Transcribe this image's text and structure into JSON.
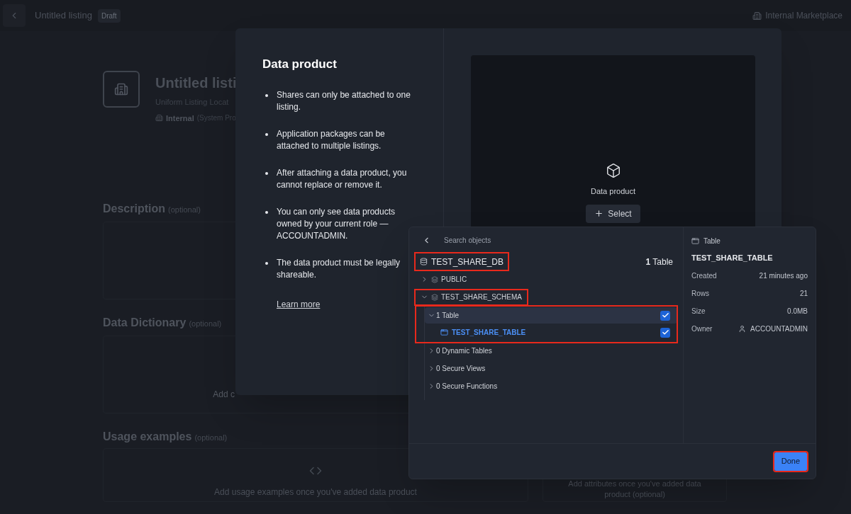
{
  "top_bar": {
    "title": "Untitled listing",
    "badge": "Draft",
    "workspace": "Internal Marketplace"
  },
  "listing": {
    "title": "Untitled listi",
    "locator": "Uniform Listing Locat",
    "visibility": "Internal",
    "visibility_note": "(System Pro"
  },
  "sections": [
    {
      "title": "Description",
      "note": "(optional)"
    },
    {
      "title": "Data Dictionary",
      "note": "(optional)",
      "hint": "Add c"
    }
  ],
  "usage": {
    "title": "Usage examples",
    "note": "(optional)",
    "hint": "Add usage examples once you've added data product",
    "side_hint": "Add attributes once you've added data product (optional)"
  },
  "modal": {
    "title": "Data product",
    "bullets": [
      "Shares can only be attached to one listing.",
      "Application packages can be attached to multiple listings.",
      "After attaching a data product, you cannot replace or remove it.",
      "You can only see data products owned by your current role — ACCOUNTADMIN.",
      "The data product must be legally shareable."
    ],
    "link": "Learn more",
    "preview": {
      "label": "Data product",
      "button": "Select"
    }
  },
  "picker": {
    "search_placeholder": "Search objects",
    "database": {
      "name": "TEST_SHARE_DB",
      "count": "**1** Table",
      "highlighted": true
    },
    "schemas": [
      {
        "name": "PUBLIC",
        "expanded": false,
        "highlighted": false
      },
      {
        "name": "TEST_SHARE_SCHEMA",
        "expanded": true,
        "highlighted": true,
        "groups": [
          {
            "label": "1 Table",
            "expanded": true,
            "checked": true,
            "highlighted": true,
            "children": [
              {
                "name": "TEST_SHARE_TABLE",
                "checked": true
              }
            ]
          },
          {
            "label": "0 Dynamic Tables",
            "expanded": false,
            "highlighted": false
          },
          {
            "label": "0 Secure Views",
            "expanded": false,
            "highlighted": false
          },
          {
            "label": "0 Secure Functions",
            "expanded": false,
            "highlighted": false
          }
        ]
      }
    ],
    "detail": {
      "type": "Table",
      "name": "TEST_SHARE_TABLE",
      "fields": [
        {
          "label": "Created",
          "value": "21 minutes ago",
          "kind": "text"
        },
        {
          "label": "Rows",
          "value": "21",
          "kind": "text"
        },
        {
          "label": "Size",
          "value": "0.0MB",
          "kind": "text"
        },
        {
          "label": "Owner",
          "value": "ACCOUNTADMIN",
          "kind": "user"
        }
      ]
    },
    "done_button": {
      "label": "Done",
      "highlighted": true
    }
  }
}
